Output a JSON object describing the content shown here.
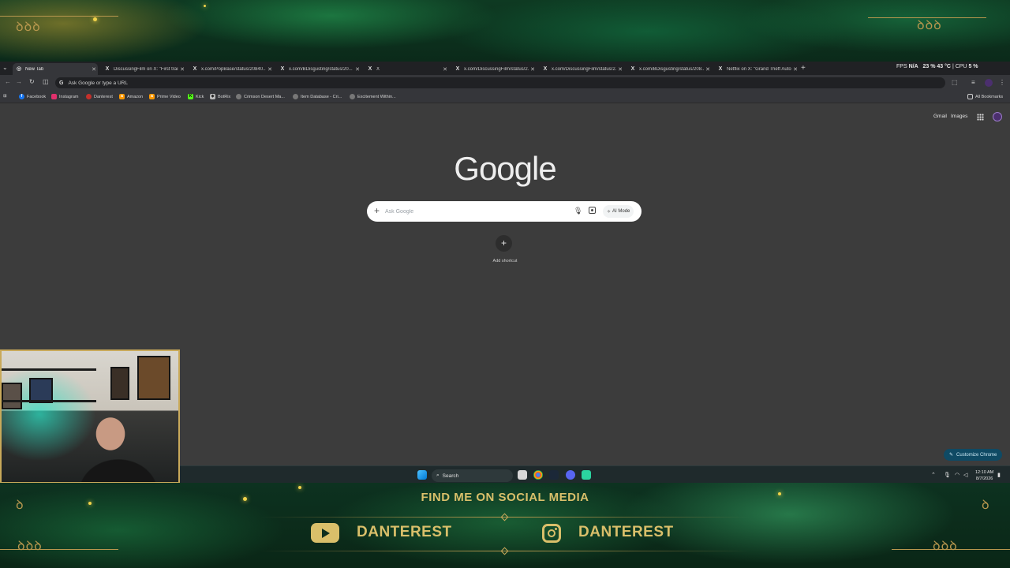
{
  "overlay": {
    "social_title": "FIND ME ON SOCIAL MEDIA",
    "youtube_handle": "DANTEREST",
    "instagram_handle": "DANTEREST",
    "accent_color": "#d9bf6a"
  },
  "tabs": [
    {
      "title": "New Tab",
      "icon": "chrome-icon",
      "active": true
    },
    {
      "title": "DiscussingFilm on X: \"First trail",
      "icon": "x-icon"
    },
    {
      "title": "x.com/PopBase/status/20840...",
      "icon": "x-icon"
    },
    {
      "title": "x.com/BDisgusting/status/20...",
      "icon": "x-icon"
    },
    {
      "title": "X",
      "icon": "x-icon"
    },
    {
      "title": "x.com/DiscussingFilm/status/2...",
      "icon": "x-icon"
    },
    {
      "title": "x.com/DiscussingFilm/status/2...",
      "icon": "x-icon"
    },
    {
      "title": "x.com/BDisgusting/status/208...",
      "icon": "x-icon"
    },
    {
      "title": "Netflix on X: \"Grand Theft Auto",
      "icon": "x-icon"
    }
  ],
  "stats": {
    "fps_label": "FPS",
    "fps_value": "N/A",
    "gpu_value": "23 %",
    "temp_value": "43 °C",
    "cpu_label": "CPU",
    "cpu_value": "5 %"
  },
  "omnibox": {
    "placeholder": "Ask Google or type a URL"
  },
  "bookmarks": [
    {
      "label": "Facebook",
      "color": "#1877f2"
    },
    {
      "label": "Instagram",
      "color": "#e1306c"
    },
    {
      "label": "Danterest",
      "color": "#c4302b"
    },
    {
      "label": "Amazon",
      "color": "#ff9900"
    },
    {
      "label": "Prime Video",
      "color": "#ff9900"
    },
    {
      "label": "Kick",
      "color": "#53fc18"
    },
    {
      "label": "BotRix",
      "color": "#bbbbbb"
    },
    {
      "label": "Crimson Desert Ma...",
      "color": "#888888"
    },
    {
      "label": "Item Database - Cri...",
      "color": "#888888"
    },
    {
      "label": "Excitement Within...",
      "color": "#888888"
    }
  ],
  "all_bookmarks_label": "All Bookmarks",
  "ntp": {
    "gmail": "Gmail",
    "images": "Images",
    "logo_text": "Google",
    "search_placeholder": "Ask Google",
    "ai_mode": "AI Mode",
    "add_shortcut": "Add shortcut",
    "customize": "Customize Chrome"
  },
  "taskbar": {
    "search_label": "Search",
    "time": "12:10 AM",
    "date": "8/7/2026"
  }
}
